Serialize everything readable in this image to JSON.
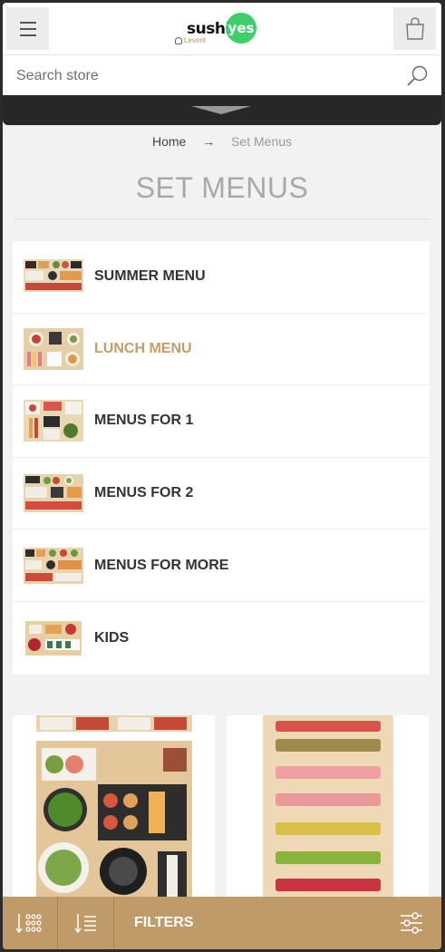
{
  "header": {
    "logo_text": "sushi",
    "logo_badge": "yes",
    "branch": "Levent"
  },
  "search": {
    "placeholder": "Search store"
  },
  "breadcrumb": {
    "home": "Home",
    "separator": "→",
    "current": "Set Menus"
  },
  "page_title": "SET MENUS",
  "categories": [
    {
      "label": "SUMMER MENU",
      "active": false
    },
    {
      "label": "LUNCH MENU",
      "active": true
    },
    {
      "label": "MENUS FOR 1",
      "active": false
    },
    {
      "label": "MENUS FOR 2",
      "active": false
    },
    {
      "label": "MENUS FOR MORE",
      "active": false
    },
    {
      "label": "KIDS",
      "active": false
    }
  ],
  "bottom_bar": {
    "filters_label": "FILTERS"
  },
  "colors": {
    "accent": "#c49e64",
    "bar": "#bf9b69",
    "logo_green": "#3ecf6a"
  }
}
